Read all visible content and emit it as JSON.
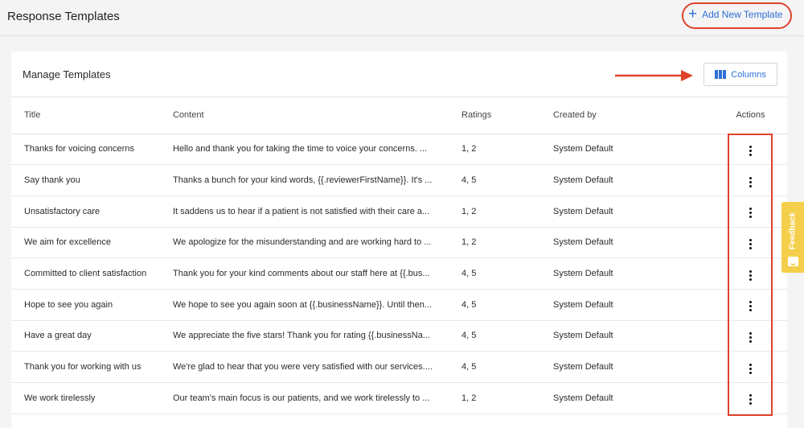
{
  "header": {
    "title": "Response Templates",
    "add_button_label": "Add New Template",
    "add_icon": "plus-icon"
  },
  "card": {
    "title": "Manage Templates",
    "columns_button_label": "Columns",
    "columns_icon": "columns-icon"
  },
  "table": {
    "columns": [
      "Title",
      "Content",
      "Ratings",
      "Created by",
      "Actions"
    ],
    "rows": [
      {
        "title": "Thanks for voicing concerns",
        "content": "Hello and thank you for taking the time to voice your concerns. ...",
        "ratings": "1, 2",
        "created_by": "System Default"
      },
      {
        "title": "Say thank you",
        "content": "Thanks a bunch for your kind words, {{.reviewerFirstName}}. It's ...",
        "ratings": "4, 5",
        "created_by": "System Default"
      },
      {
        "title": "Unsatisfactory care",
        "content": "It saddens us to hear if a patient is not satisfied with their care a...",
        "ratings": "1, 2",
        "created_by": "System Default"
      },
      {
        "title": "We aim for excellence",
        "content": "We apologize for the misunderstanding and are working hard to ...",
        "ratings": "1, 2",
        "created_by": "System Default"
      },
      {
        "title": "Committed to client satisfaction",
        "content": "Thank you for your kind comments about our staff here at {{.bus...",
        "ratings": "4, 5",
        "created_by": "System Default"
      },
      {
        "title": "Hope to see you again",
        "content": "We hope to see you again soon at {{.businessName}}. Until then...",
        "ratings": "4, 5",
        "created_by": "System Default"
      },
      {
        "title": "Have a great day",
        "content": "We appreciate the five stars! Thank you for rating {{.businessNa...",
        "ratings": "4, 5",
        "created_by": "System Default"
      },
      {
        "title": "Thank you for working with us",
        "content": "We're glad to hear that you were very satisfied with our services....",
        "ratings": "4, 5",
        "created_by": "System Default"
      },
      {
        "title": "We work tirelessly",
        "content": "Our team's main focus is our patients, and we work tirelessly to ...",
        "ratings": "1, 2",
        "created_by": "System Default"
      }
    ]
  },
  "feedback": {
    "label": "Feedback",
    "icon": "smiley-icon",
    "color": "#f4cf4b"
  },
  "colors": {
    "accent": "#2f6fd6",
    "highlight": "#e0422b"
  }
}
